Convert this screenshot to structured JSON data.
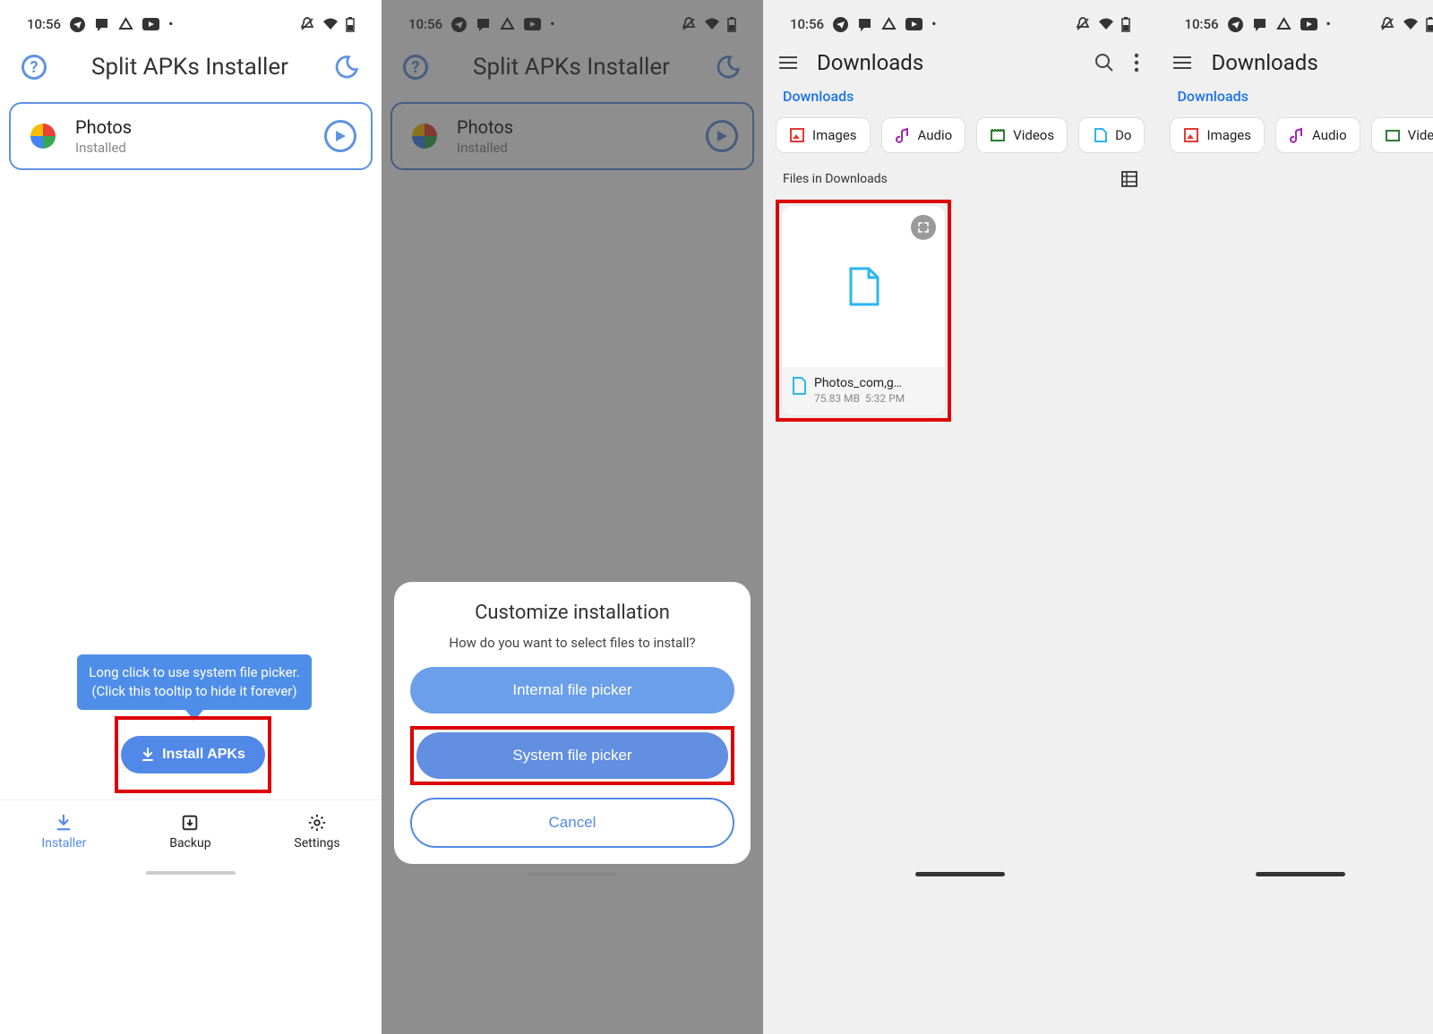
{
  "status": {
    "time": "10:56",
    "icons": [
      "telegram",
      "chat",
      "drive",
      "youtube",
      "dot"
    ]
  },
  "sai": {
    "title": "Split APKs Installer",
    "app": {
      "name": "Photos",
      "status": "Installed"
    },
    "tooltip": {
      "line1": "Long click to use system file picker.",
      "line2": "(Click this tooltip to hide it forever)"
    },
    "install_label": "Install APKs",
    "nav": {
      "installer": "Installer",
      "backup": "Backup",
      "settings": "Settings"
    }
  },
  "sheet": {
    "title": "Customize installation",
    "subtitle": "How do you want to select files to install?",
    "internal": "Internal file picker",
    "system": "System file picker",
    "cancel": "Cancel"
  },
  "files": {
    "title": "Downloads",
    "breadcrumb": "Downloads",
    "chips": {
      "images": "Images",
      "audio": "Audio",
      "videos": "Videos",
      "documents": "Do"
    },
    "section": "Files in Downloads",
    "item": {
      "name": "Photos_com,g…",
      "size": "75.83 MB",
      "time": "5:32 PM"
    }
  }
}
